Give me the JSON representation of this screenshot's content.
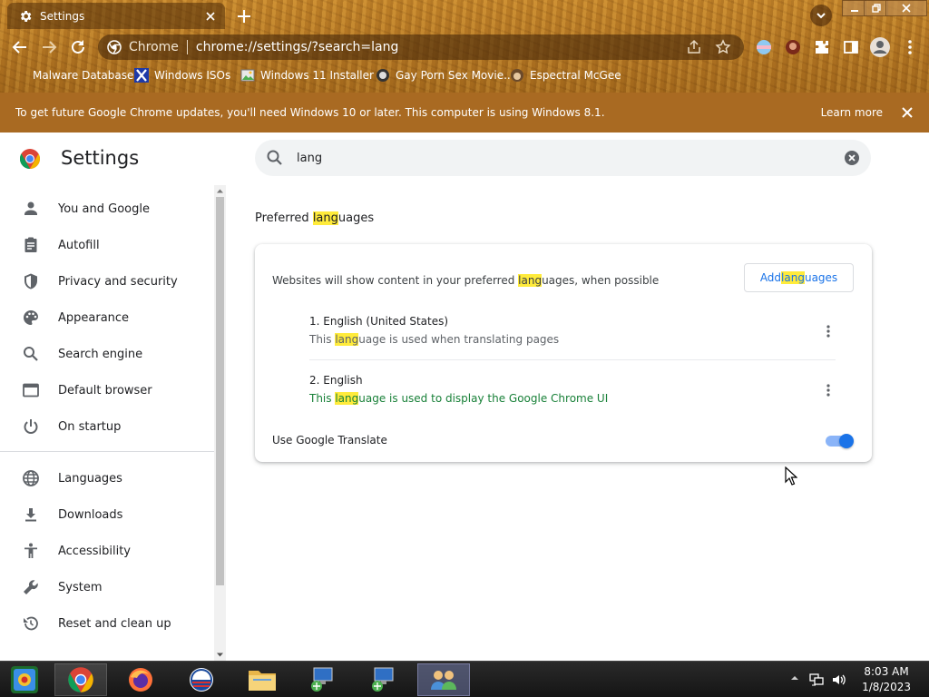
{
  "browser": {
    "tab_title": "Settings",
    "site_name": "Chrome",
    "url": "chrome://settings/?search=lang",
    "bookmarks": [
      {
        "label": "Malware Database"
      },
      {
        "label": "Windows ISOs"
      },
      {
        "label": "Windows 11 Installer"
      },
      {
        "label": "Gay Porn Sex Movie..."
      },
      {
        "label": "Espectral McGee"
      }
    ]
  },
  "infobar": {
    "message": "To get future Google Chrome updates, you'll need Windows 10 or later. This computer is using Windows 8.1.",
    "learn_more": "Learn more"
  },
  "settings": {
    "title": "Settings",
    "search_value": "lang",
    "nav_items": [
      {
        "label": "You and Google",
        "icon": "person-icon"
      },
      {
        "label": "Autofill",
        "icon": "clipboard-icon"
      },
      {
        "label": "Privacy and security",
        "icon": "shield-icon"
      },
      {
        "label": "Appearance",
        "icon": "palette-icon"
      },
      {
        "label": "Search engine",
        "icon": "search-icon"
      },
      {
        "label": "Default browser",
        "icon": "browser-icon"
      },
      {
        "label": "On startup",
        "icon": "power-icon"
      },
      {
        "label": "Languages",
        "icon": "globe-icon"
      },
      {
        "label": "Downloads",
        "icon": "download-icon"
      },
      {
        "label": "Accessibility",
        "icon": "accessibility-icon"
      },
      {
        "label": "System",
        "icon": "wrench-icon"
      },
      {
        "label": "Reset and clean up",
        "icon": "history-icon"
      }
    ],
    "section": {
      "title_pre": "Preferred ",
      "title_hl": "lang",
      "title_post": "uages",
      "desc_pre": "Websites will show content in your preferred ",
      "desc_hl": "lang",
      "desc_post": "uages, when possible",
      "add_pre": "Add ",
      "add_hl": "lang",
      "add_post": "uages",
      "languages": [
        {
          "name": "1. English (United States)",
          "sub_pre": "This ",
          "sub_hl": "lang",
          "sub_post": "uage is used when translating pages",
          "sub_color": "#5f6368"
        },
        {
          "name": "2. English",
          "sub_pre": "This ",
          "sub_hl": "lang",
          "sub_post": "uage is used to display the Google Chrome UI",
          "sub_color": "#188038"
        }
      ],
      "translate_label": "Use Google Translate",
      "translate_on": true
    }
  },
  "taskbar": {
    "time": "8:03 AM",
    "date": "1/8/2023"
  },
  "colors": {
    "accent": "#1a73e8",
    "highlight": "#ffeb3b",
    "toggle_track": "#8ab4f8",
    "toggle_knob": "#1a73e8",
    "infobar": "#a96a22"
  }
}
